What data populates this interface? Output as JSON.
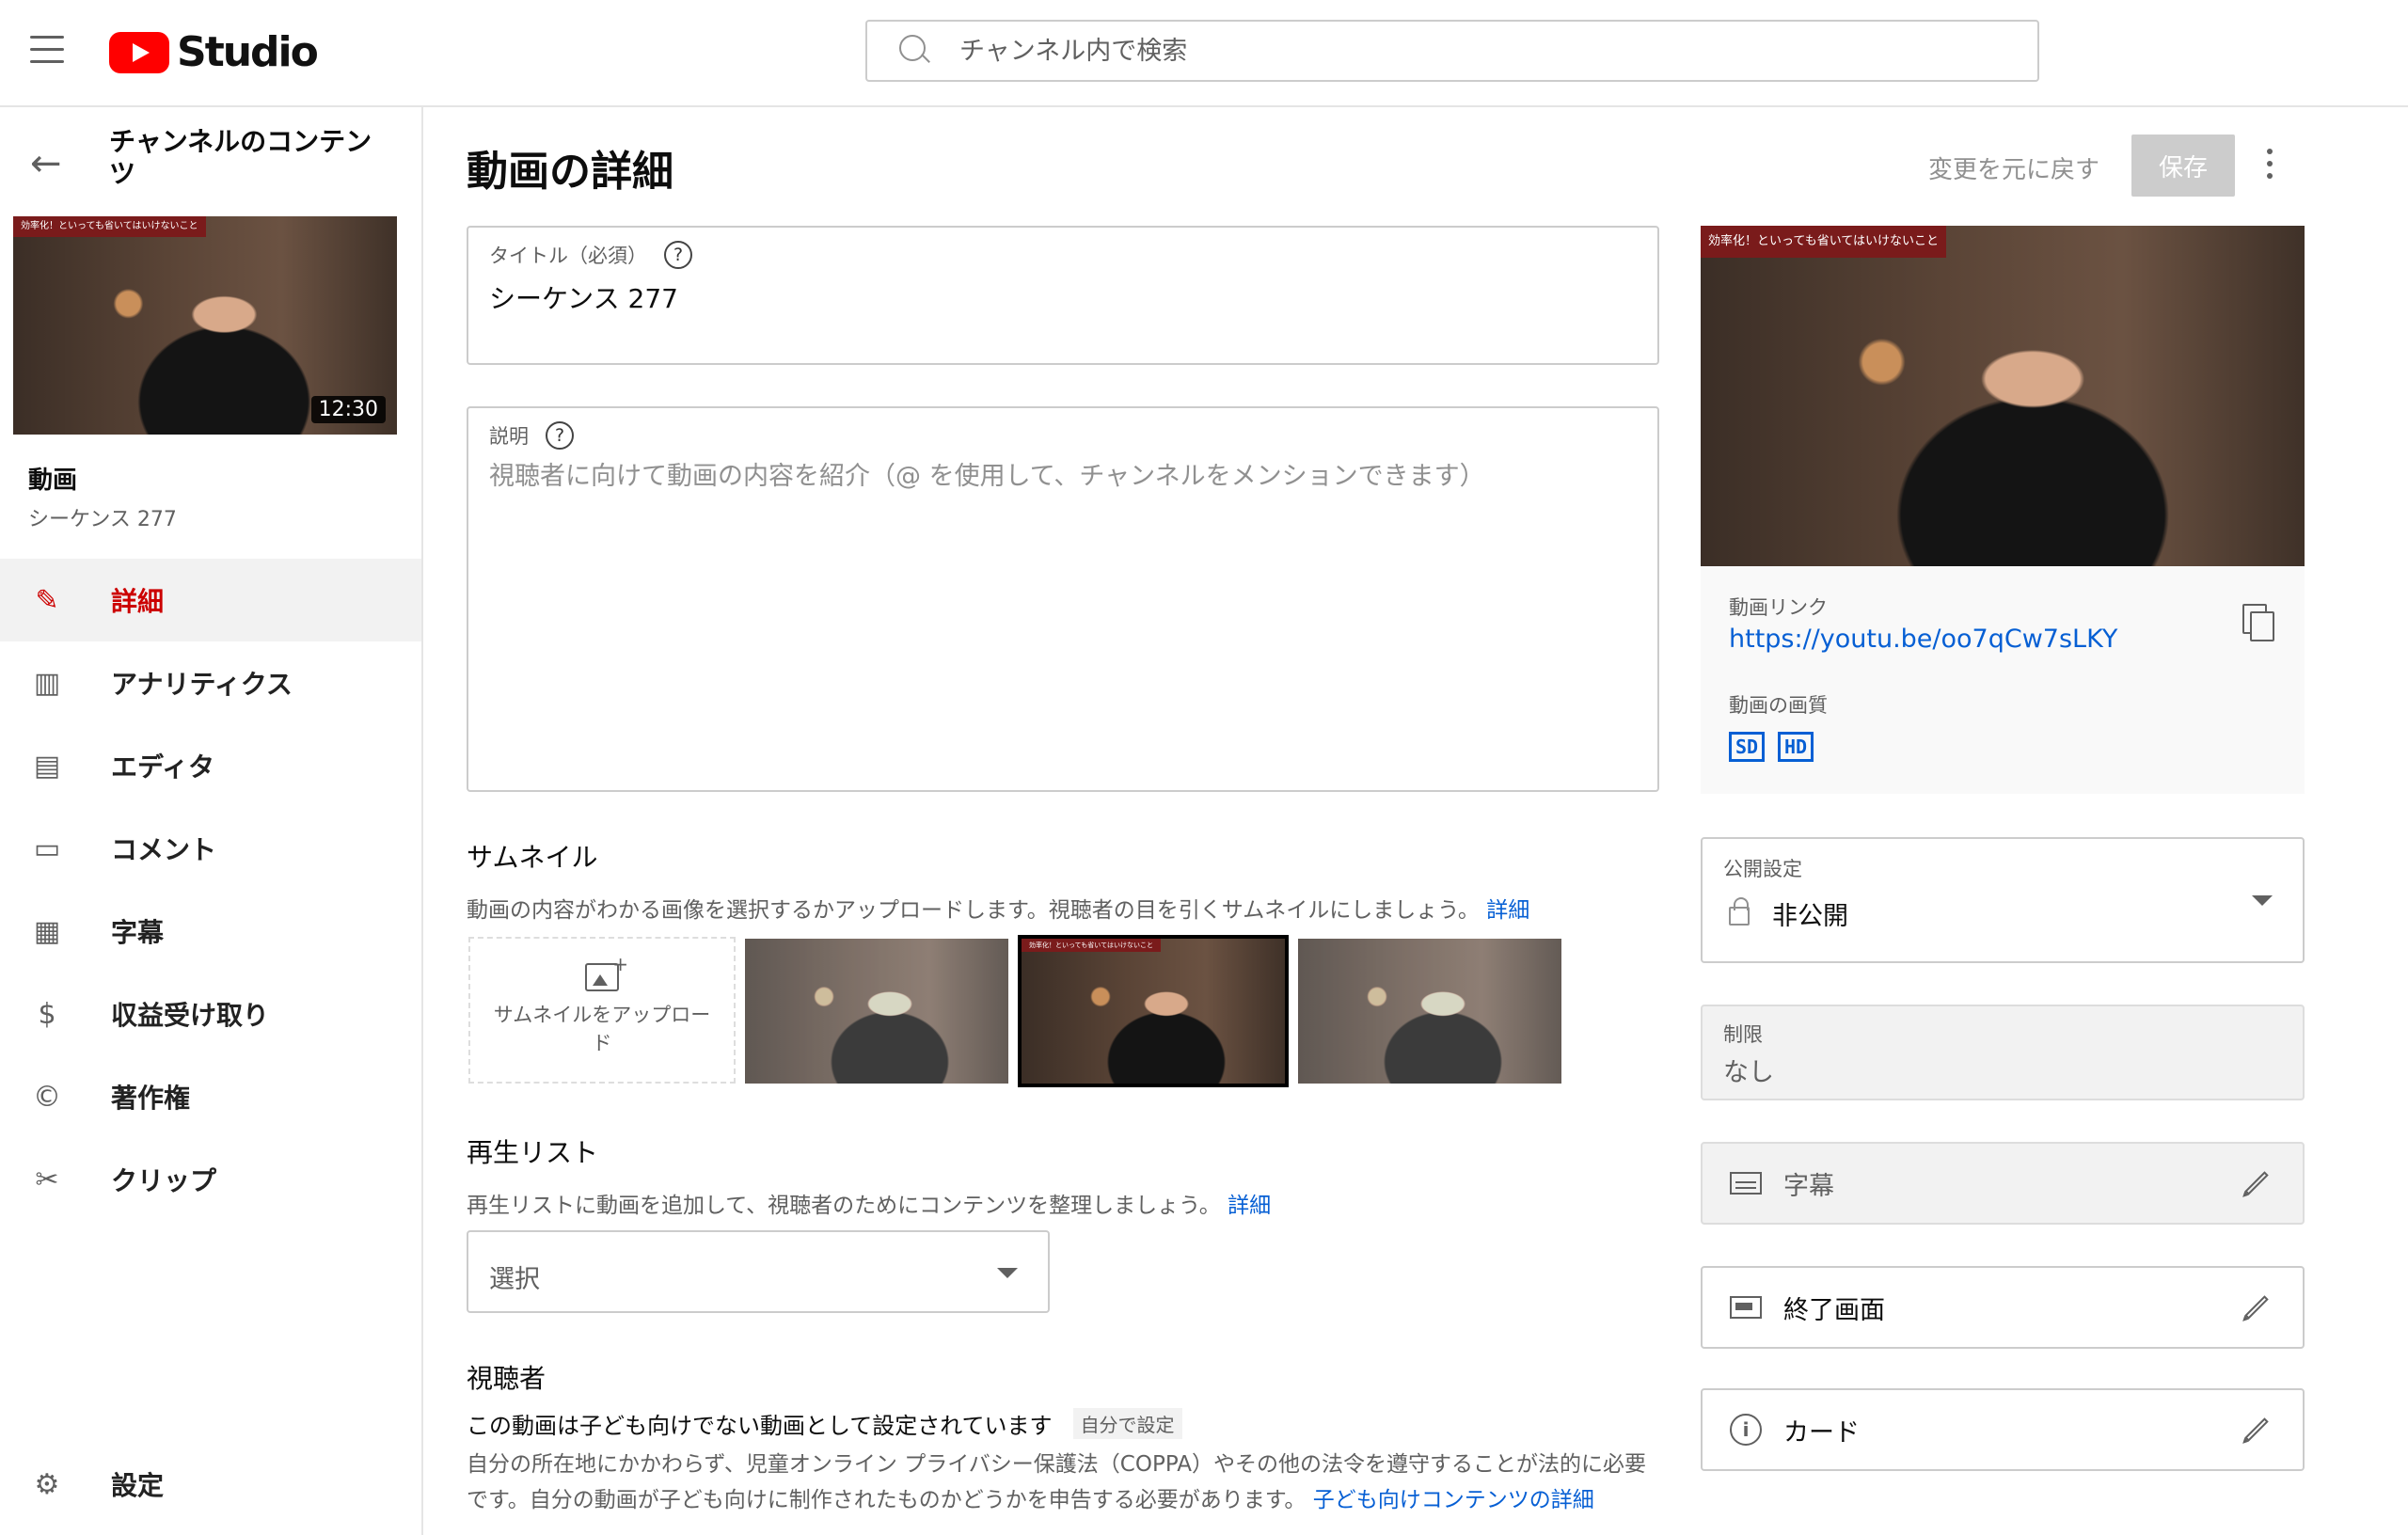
{
  "header": {
    "logo_text": "Studio",
    "search_placeholder": "チャンネル内で検索"
  },
  "sidebar": {
    "channel_title": "チャンネルのコンテンツ",
    "thumbnail": {
      "banner_text": "効率化！といっても省いてはいけないこと",
      "duration": "12:30"
    },
    "video_label": "動画",
    "video_name": "シーケンス 277",
    "items": [
      {
        "label": "詳細",
        "icon": "pencil-icon",
        "active": true
      },
      {
        "label": "アナリティクス",
        "icon": "analytics-icon",
        "active": false
      },
      {
        "label": "エディタ",
        "icon": "editor-icon",
        "active": false
      },
      {
        "label": "コメント",
        "icon": "comment-icon",
        "active": false
      },
      {
        "label": "字幕",
        "icon": "subtitles-icon",
        "active": false
      },
      {
        "label": "収益受け取り",
        "icon": "dollar-icon",
        "active": false
      },
      {
        "label": "著作権",
        "icon": "copyright-icon",
        "active": false
      },
      {
        "label": "クリップ",
        "icon": "scissors-icon",
        "active": false
      }
    ],
    "settings_label": "設定"
  },
  "main": {
    "page_title": "動画の詳細",
    "undo_label": "変更を元に戻す",
    "save_label": "保存",
    "title_field": {
      "label": "タイトル（必須）",
      "value": "シーケンス 277"
    },
    "description_field": {
      "label": "説明",
      "placeholder": "視聴者に向けて動画の内容を紹介（@ を使用して、チャンネルをメンションできます）"
    },
    "thumbnail": {
      "title": "サムネイル",
      "description": "動画の内容がわかる画像を選択するかアップロードします。視聴者の目を引くサムネイルにしましょう。",
      "link": "詳細",
      "upload_label": "サムネイルをアップロード",
      "selected_index": 1
    },
    "playlist": {
      "title": "再生リスト",
      "description": "再生リストに動画を追加して、視聴者のためにコンテンツを整理しましょう。",
      "link": "詳細",
      "select_value": "選択"
    },
    "audience": {
      "title": "視聴者",
      "status": "この動画は子ども向けでない動画として設定されています",
      "chip": "自分で設定",
      "description": "自分の所在地にかかわらず、児童オンライン プライバシー保護法（COPPA）やその他の法令を遵守することが法的に必要です。自分の動画が子ども向けに制作されたものかどうかを申告する必要があります。",
      "link": "子ども向けコンテンツの詳細"
    }
  },
  "right": {
    "preview_banner": "効率化！といっても省いてはいけないこと",
    "video_link_label": "動画リンク",
    "video_link": "https://youtu.be/oo7qCw7sLKY",
    "quality_label": "動画の画質",
    "quality_badges": [
      "SD",
      "HD"
    ],
    "visibility": {
      "label": "公開設定",
      "value": "非公開"
    },
    "restriction": {
      "label": "制限",
      "value": "なし"
    },
    "subtitles_label": "字幕",
    "end_screen_label": "終了画面",
    "cards_label": "カード"
  },
  "colors": {
    "accent_red": "#cc0000",
    "link_blue": "#065fd4",
    "youtube_red": "#ff0000"
  }
}
